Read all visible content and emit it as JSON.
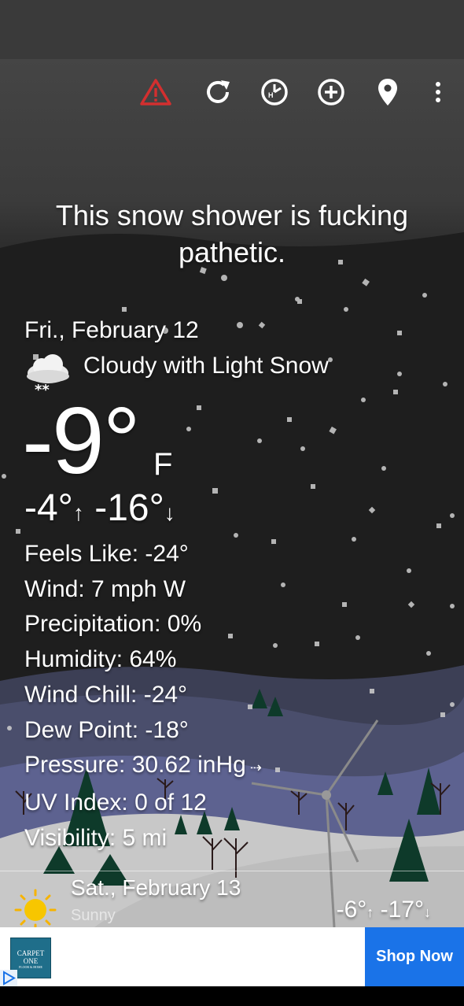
{
  "toolbar": {
    "icons": [
      "warning-icon",
      "refresh-icon",
      "hourly-icon",
      "add-location-icon",
      "location-pin-icon",
      "more-icon"
    ],
    "colors": {
      "warning": "#d32f2f",
      "default": "#ffffff"
    }
  },
  "headline": "This snow shower is fucking pathetic.",
  "current": {
    "date": "Fri., February 12",
    "condition": "Cloudy with Light Snow",
    "condition_icon": "cloud-snow-icon",
    "temp": "-9°",
    "unit": "F",
    "high": "-4°",
    "low": "-16°",
    "up_arrow": "↑",
    "down_arrow": "↓"
  },
  "details": [
    "Feels Like: -24°",
    "Wind: 7 mph W",
    "Precipitation: 0%",
    "Humidity: 64%",
    "Wind Chill: -24°",
    "Dew Point: -18°",
    "Pressure: 30.62 inHg",
    "UV Index: 0 of 12",
    "Visibility: 5 mi"
  ],
  "pressure_trend_icon": "arrow-right-icon",
  "forecast": {
    "date": "Sat., February 13",
    "condition": "Sunny",
    "icon": "sun-icon",
    "high": "-6°",
    "low": "-17°",
    "up_arrow": "↑",
    "down_arrow": "↓"
  },
  "ad": {
    "logo_line1": "CARPET",
    "logo_line2": "ONE",
    "logo_line3": "FLOOR & HOME",
    "button_label": "Shop Now",
    "button_color": "#1a73e8"
  }
}
